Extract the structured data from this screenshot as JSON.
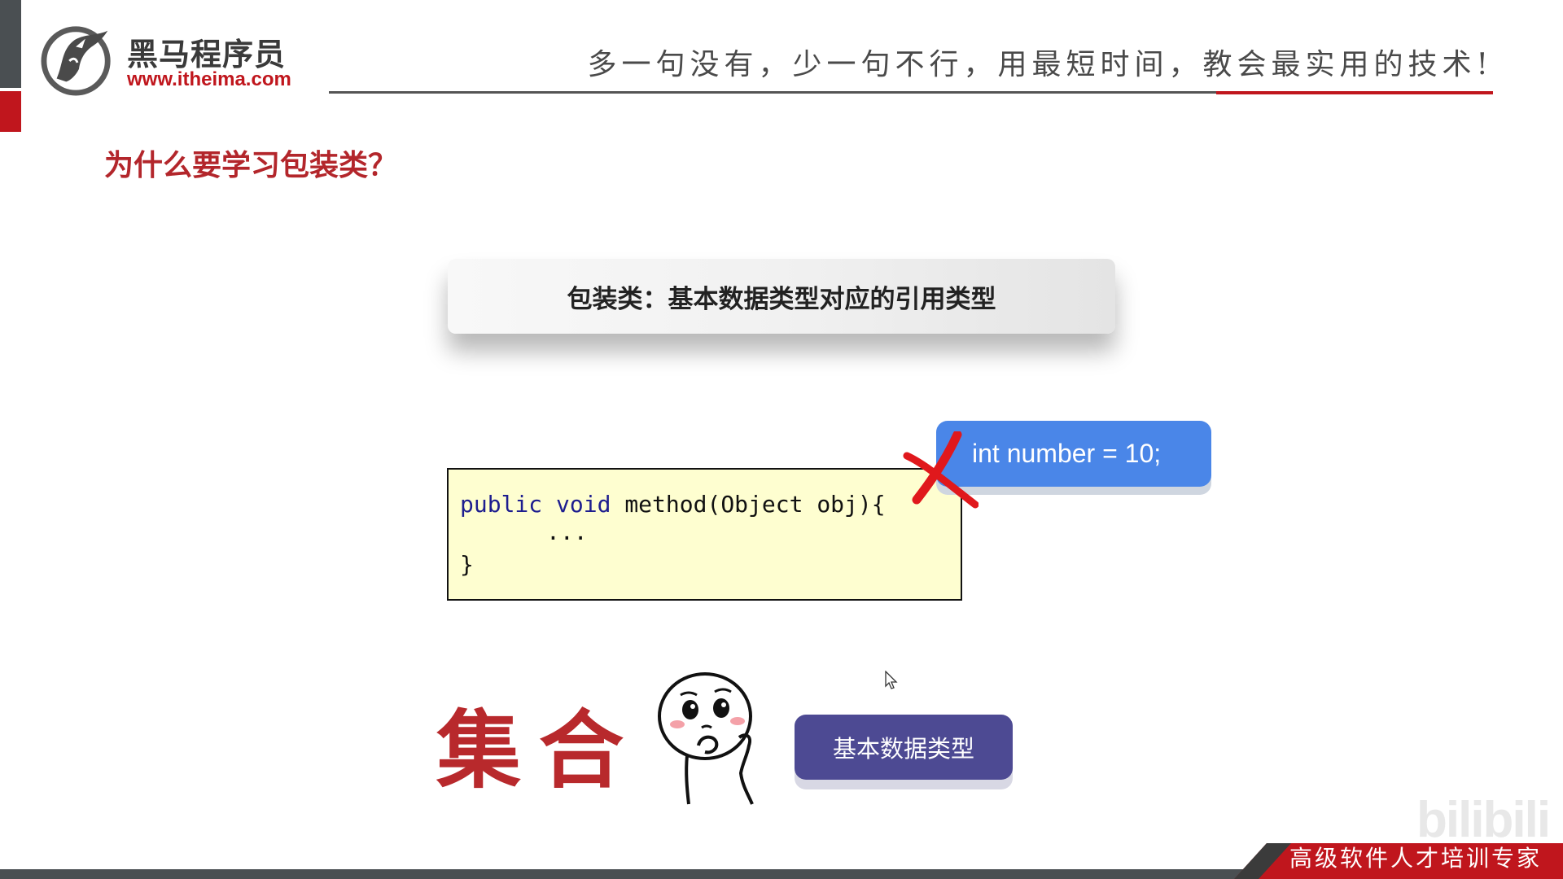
{
  "header": {
    "logo_title": "黑马程序员",
    "logo_url": "www.itheima.com",
    "slogan": "多一句没有，少一句不行，用最短时间，教会最实用的技术!"
  },
  "slide": {
    "section_title": "为什么要学习包装类？",
    "definition": "包装类：基本数据类型对应的引用类型",
    "code_lines": {
      "line1_kw1": "public",
      "line1_kw2": "void",
      "line1_rest": "method(Object obj){",
      "line2": "...",
      "line3": "}"
    },
    "bubble_text": "int number = 10;",
    "collection_text": "集合",
    "basic_type_button": "基本数据类型"
  },
  "footer": {
    "tagline": "高级软件人才培训专家",
    "watermark": "bilibili"
  },
  "colors": {
    "brand_red": "#c0161d",
    "bubble_blue": "#4a86e8",
    "button_purple": "#4d4a93",
    "code_bg": "#fefed0"
  },
  "icons": {
    "logo": "horse-head-logo",
    "cross": "red-cross-mark",
    "face": "thinking-face-sticker",
    "cursor": "mouse-pointer"
  }
}
